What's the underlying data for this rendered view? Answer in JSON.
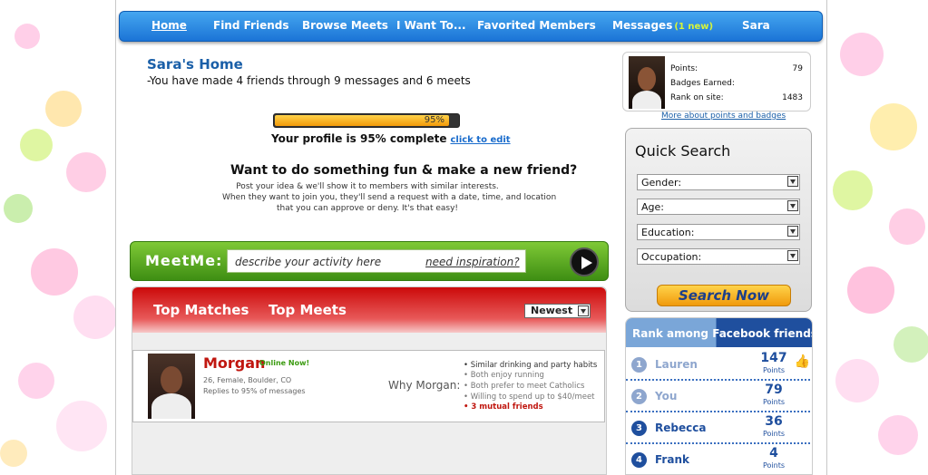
{
  "nav": {
    "items": [
      "Home",
      "Find Friends",
      "Browse Meets",
      "I Want To...",
      "Favorited Members",
      "Messages",
      "Sara"
    ],
    "messages_badge": "(1 new)"
  },
  "home": {
    "title": "Sara's Home",
    "subtitle": "-You have made 4 friends through 9 messages and 6 meets"
  },
  "profile": {
    "progress_percent": 95,
    "progress_label": "95%",
    "complete_text": "Your profile is 95% complete",
    "edit_link": "click to edit"
  },
  "fun": {
    "title": "Want to do something fun & make a new friend?",
    "lines": [
      "Post your idea & we'll show it to members with similar interests.",
      "When they want to join you, they'll send a request with a date, time, and location",
      "that you can approve or deny.  It's that easy!"
    ]
  },
  "meetme": {
    "label": "MeetMe:",
    "placeholder": "describe your activity here",
    "inspiration": "need inspiration?"
  },
  "matches": {
    "tabs": [
      "Top Matches",
      "Top Meets"
    ],
    "sort_value": "Newest",
    "card": {
      "name": "Morgan",
      "status": "Online Now!",
      "info1": "26, Female, Boulder, CO",
      "info2": "Replies to 95% of messages",
      "why": "Why Morgan:",
      "reasons": [
        "• Similar drinking and party habits",
        "• Both enjoy running",
        "• Both prefer to meet Catholics",
        "• Willing to spend up to $40/meet",
        "• 3 mutual friends"
      ]
    }
  },
  "stats": {
    "points_label": "Points:",
    "points": "79",
    "badges_label": "Badges Earned:",
    "rank_label": "Rank on site:",
    "rank": "1483",
    "more_link": "More about points and badges"
  },
  "quick_search": {
    "title": "Quick Search",
    "fields": [
      "Gender:",
      "Age:",
      "Education:",
      "Occupation:"
    ],
    "button": "Search Now"
  },
  "rank": {
    "title": "Rank among Facebook friends",
    "rows": [
      {
        "num": "1",
        "name": "Lauren",
        "points": "147",
        "points_label": "Points"
      },
      {
        "num": "2",
        "name": "You",
        "points": "79",
        "points_label": "Points"
      },
      {
        "num": "3",
        "name": "Rebecca",
        "points": "36",
        "points_label": "Points"
      },
      {
        "num": "4",
        "name": "Frank",
        "points": "4",
        "points_label": "Points"
      }
    ]
  },
  "colors": {
    "nav_blue": "#1b74d6",
    "title_blue": "#1a5fa8",
    "meetme_green": "#3e8e13",
    "matches_red": "#cc0a0a",
    "search_orange": "#f09a0c"
  }
}
